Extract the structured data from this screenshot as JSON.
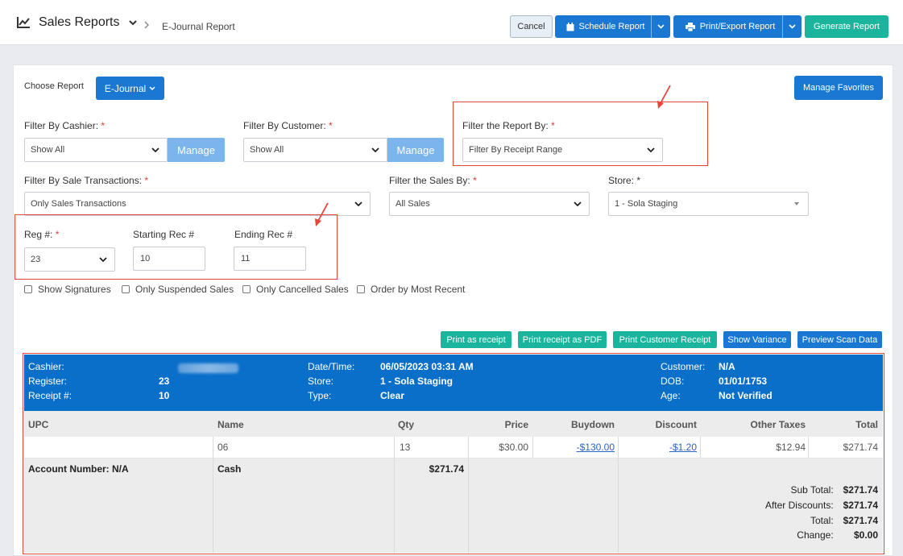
{
  "header": {
    "title": "Sales Reports",
    "breadcrumb": "E-Journal Report",
    "cancel": "Cancel",
    "schedule": "Schedule Report",
    "print_export": "Print/Export Report",
    "generate": "Generate Report"
  },
  "choose": {
    "label": "Choose Report",
    "value": "E-Journal",
    "favorites": "Manage Favorites"
  },
  "filters": {
    "cashier_label": "Filter By Cashier:",
    "cashier_value": "Show All",
    "customer_label": "Filter By Customer:",
    "customer_value": "Show All",
    "manage": "Manage",
    "report_by_label": "Filter the Report By:",
    "report_by_value": "Filter By Receipt Range",
    "sale_tx_label": "Filter By Sale Transactions:",
    "sale_tx_value": "Only Sales Transactions",
    "sales_by_label": "Filter the Sales By:",
    "sales_by_value": "All Sales",
    "store_label": "Store: *",
    "store_value": "1 - Sola Staging",
    "reg_label": "Reg #:",
    "reg_value": "23",
    "start_label": "Starting Rec #",
    "start_value": "10",
    "end_label": "Ending Rec #",
    "end_value": "11",
    "required_mark": "*"
  },
  "checkboxes": [
    "Show Signatures",
    "Only Suspended Sales",
    "Only Cancelled Sales",
    "Order by Most Recent"
  ],
  "action_buttons": [
    "Print as receipt",
    "Print receipt as PDF",
    "Print Customer Receipt",
    "Show Variance",
    "Preview Scan Data"
  ],
  "receipt": {
    "cashier_label": "Cashier:",
    "register_label": "Register:",
    "register": "23",
    "receipt_label": "Receipt #:",
    "receipt": "10",
    "datetime_label": "Date/Time:",
    "datetime": "06/05/2023 03:31 AM",
    "store_label": "Store:",
    "store": "1 - Sola Staging",
    "type_label": "Type:",
    "type": "Clear",
    "customer_label": "Customer:",
    "customer": "N/A",
    "dob_label": "DOB:",
    "dob": "01/01/1753",
    "age_label": "Age:",
    "age": "Not Verified"
  },
  "table": {
    "columns": [
      "UPC",
      "Name",
      "Qty",
      "Price",
      "Buydown",
      "Discount",
      "Other Taxes",
      "Total"
    ],
    "row": {
      "upc": "",
      "name": "06",
      "qty": "13",
      "price": "$30.00",
      "buydown": "-$130.00",
      "discount": "-$1.20",
      "other_taxes": "$12.94",
      "total": "$271.74"
    },
    "payment": {
      "account": "Account Number: N/A",
      "method": "Cash",
      "amount": "$271.74"
    },
    "totals": [
      {
        "label": "Sub Total:",
        "value": "$271.74"
      },
      {
        "label": "After Discounts:",
        "value": "$271.74"
      },
      {
        "label": "Total:",
        "value": "$271.74"
      },
      {
        "label": "Change:",
        "value": "$0.00"
      }
    ]
  }
}
